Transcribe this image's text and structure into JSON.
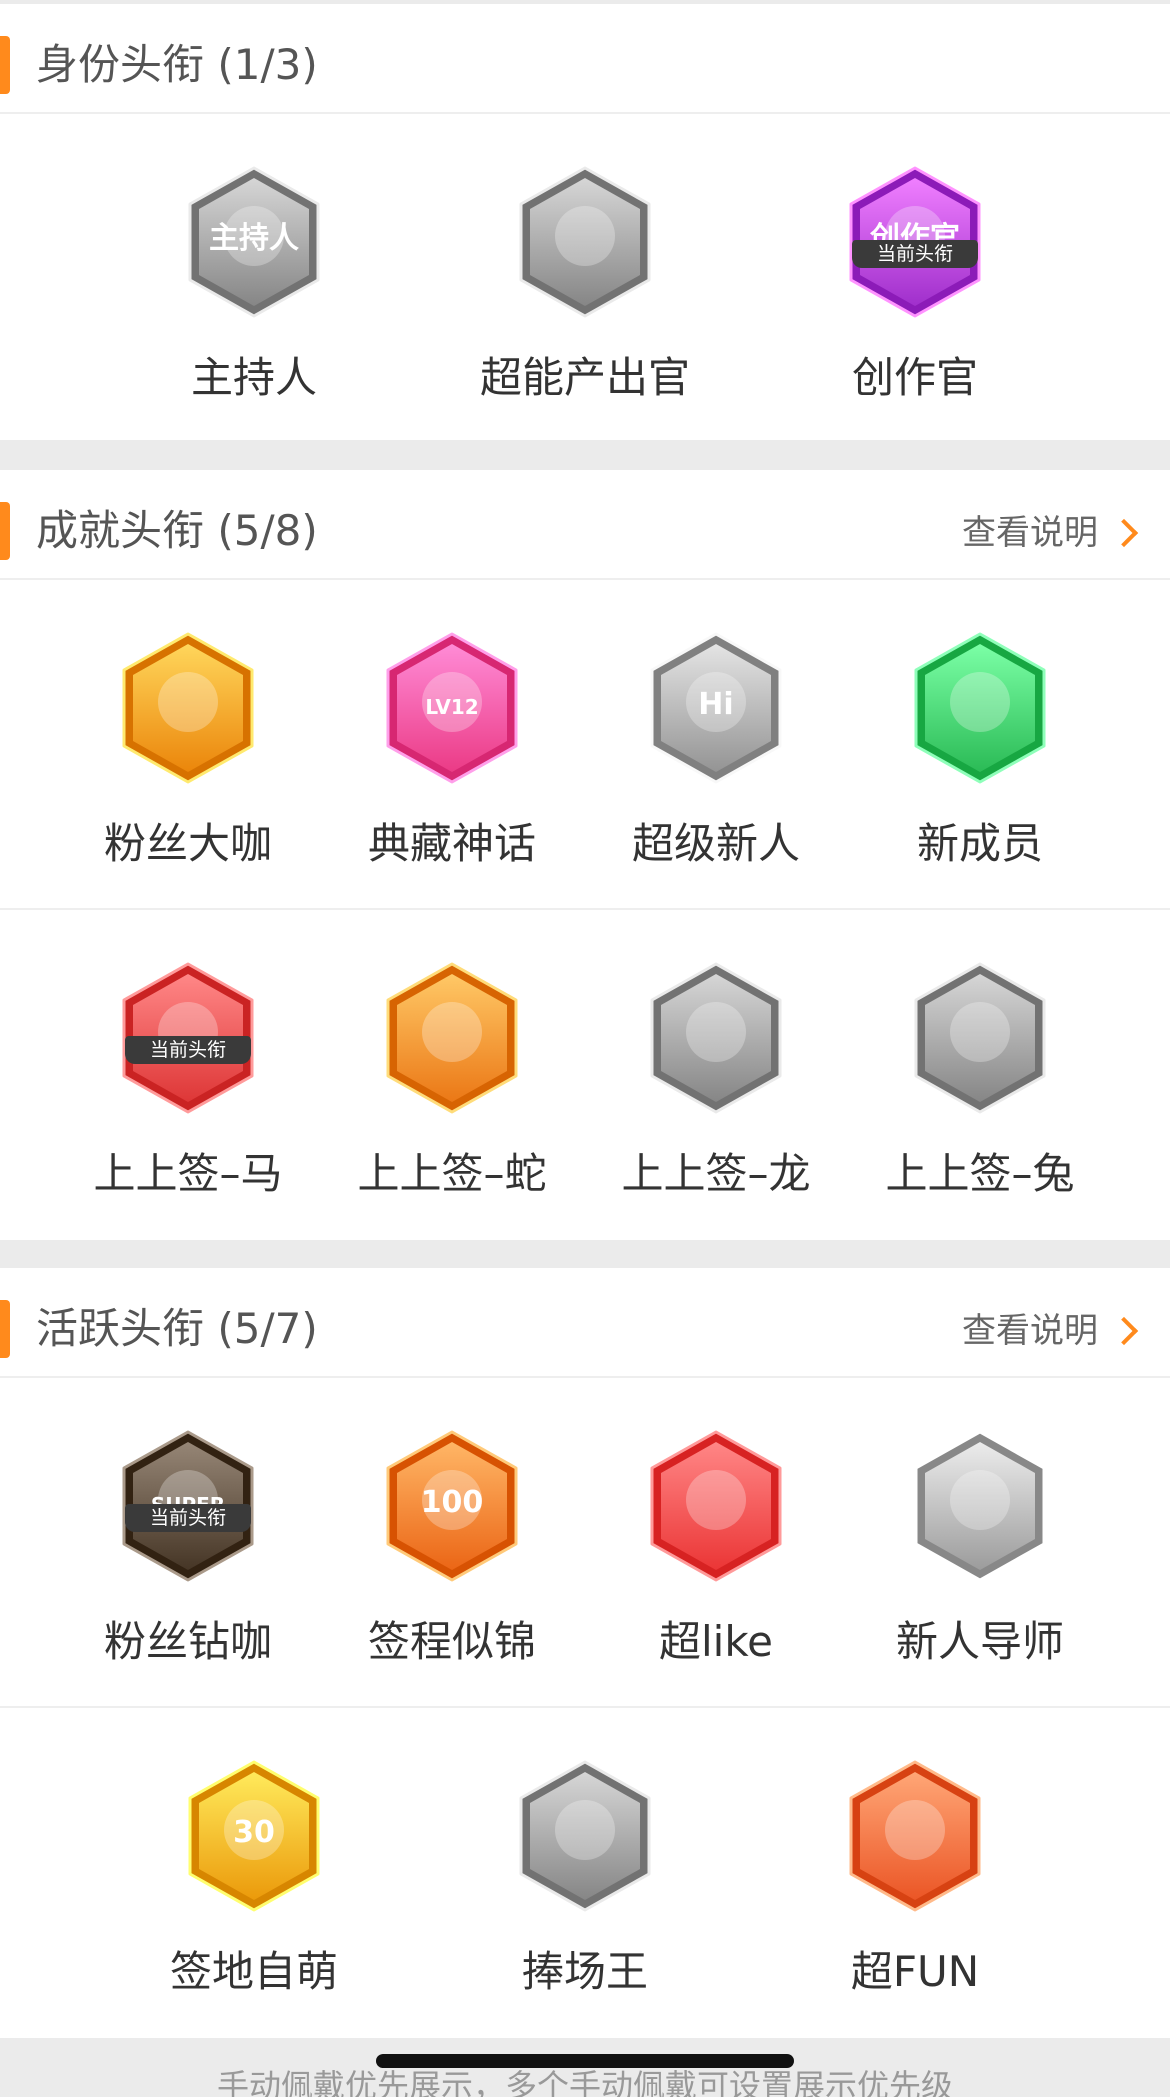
{
  "sections": [
    {
      "title": "身份头衔 (1/3)",
      "link": "",
      "rows": [
        [
          {
            "label": "主持人",
            "icon": "microphone-badge-icon",
            "color": "#9a9a9a",
            "current": false,
            "badge_text": "主持人"
          },
          {
            "label": "超能产出官",
            "icon": "rocket-badge-icon",
            "color": "#9a9a9a",
            "current": false,
            "badge_text": ""
          },
          {
            "label": "创作官",
            "icon": "pen-badge-icon",
            "color": "#b443e0",
            "current": true,
            "badge_text": "创作官"
          }
        ]
      ]
    },
    {
      "title": "成就头衔 (5/8)",
      "link": "查看说明",
      "rows": [
        [
          {
            "label": "粉丝大咖",
            "icon": "crown-badge-icon",
            "color": "#ff9a1f",
            "current": false,
            "badge_text": ""
          },
          {
            "label": "典藏神话",
            "icon": "lv12-badge-icon",
            "color": "#ff4f9a",
            "current": false,
            "badge_text": "LV12"
          },
          {
            "label": "超级新人",
            "icon": "hi-badge-icon",
            "color": "#a8a8a8",
            "current": false,
            "badge_text": "Hi"
          },
          {
            "label": "新成员",
            "icon": "hand-badge-icon",
            "color": "#3fcf6a",
            "current": false,
            "badge_text": ""
          }
        ],
        [
          {
            "label": "上上签–马",
            "icon": "horse-badge-icon",
            "color": "#f24b4b",
            "current": true,
            "badge_text": ""
          },
          {
            "label": "上上签–蛇",
            "icon": "snake-badge-icon",
            "color": "#ff8c2a",
            "current": false,
            "badge_text": ""
          },
          {
            "label": "上上签–龙",
            "icon": "dragon-badge-icon",
            "color": "#9a9a9a",
            "current": false,
            "badge_text": ""
          },
          {
            "label": "上上签–兔",
            "icon": "rabbit-badge-icon",
            "color": "#9a9a9a",
            "current": false,
            "badge_text": ""
          }
        ]
      ]
    },
    {
      "title": "活跃头衔 (5/7)",
      "link": "查看说明",
      "rows": [
        [
          {
            "label": "粉丝钻咖",
            "icon": "super-crown-badge-icon",
            "color": "#5a4a3a",
            "current": true,
            "badge_text": "SUPER"
          },
          {
            "label": "签程似锦",
            "icon": "100-days-badge-icon",
            "color": "#ff7a2a",
            "current": false,
            "badge_text": "100"
          },
          {
            "label": "超like",
            "icon": "trophy-badge-icon",
            "color": "#ff4a4a",
            "current": false,
            "badge_text": ""
          },
          {
            "label": "新人导师",
            "icon": "graduation-cap-badge-icon",
            "color": "#b0b0b0",
            "current": false,
            "badge_text": ""
          }
        ],
        [
          {
            "label": "签地自萌",
            "icon": "30-days-badge-icon",
            "color": "#ffae1f",
            "current": false,
            "badge_text": "30"
          },
          {
            "label": "捧场王",
            "icon": "cheer-badge-icon",
            "color": "#9a9a9a",
            "current": false,
            "badge_text": ""
          },
          {
            "label": "超FUN",
            "icon": "rock-hand-badge-icon",
            "color": "#ff6a3a",
            "current": false,
            "badge_text": ""
          }
        ]
      ]
    }
  ],
  "current_tag": "当前头衔",
  "footer_note": "手动佩戴优先展示，多个手动佩戴可设置展示优先级",
  "accent_color": "#ff8a1c"
}
